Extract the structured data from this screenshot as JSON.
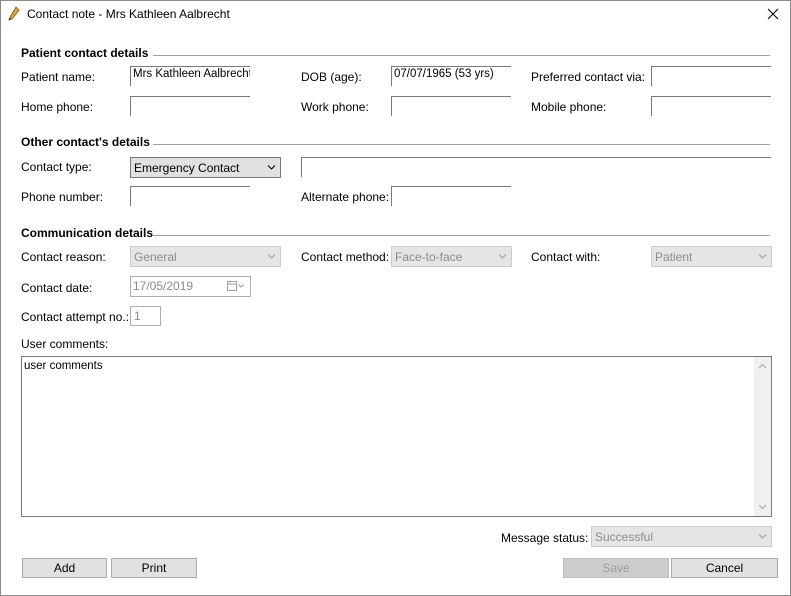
{
  "window": {
    "title": "Contact note - Mrs Kathleen Aalbrecht"
  },
  "patient_section": {
    "title": "Patient contact details",
    "patient_name_label": "Patient name:",
    "patient_name_value": "Mrs Kathleen Aalbrecht",
    "dob_label": "DOB (age):",
    "dob_value": "07/07/1965 (53 yrs)",
    "preferred_label": "Preferred contact via:",
    "preferred_value": "",
    "home_phone_label": "Home phone:",
    "home_phone_value": "",
    "work_phone_label": "Work phone:",
    "work_phone_value": "",
    "mobile_phone_label": "Mobile phone:",
    "mobile_phone_value": ""
  },
  "other_section": {
    "title": "Other contact's details",
    "contact_type_label": "Contact type:",
    "contact_type_value": "Emergency Contact",
    "contact_name_value": "",
    "phone_label": "Phone number:",
    "phone_value": "",
    "alt_phone_label": "Alternate phone:",
    "alt_phone_value": ""
  },
  "comm_section": {
    "title": "Communication details",
    "reason_label": "Contact reason:",
    "reason_value": "General",
    "method_label": "Contact method:",
    "method_value": "Face-to-face",
    "with_label": "Contact with:",
    "with_value": "Patient",
    "date_label": "Contact date:",
    "date_value": "17/05/2019",
    "attempt_label": "Contact attempt no.:",
    "attempt_value": "1",
    "comments_label": "User comments:",
    "comments_value": "user comments"
  },
  "footer": {
    "status_label": "Message status:",
    "status_value": "Successful",
    "add_label": "Add",
    "print_label": "Print",
    "save_label": "Save",
    "cancel_label": "Cancel"
  },
  "icons": {
    "app": "pen-nib-icon",
    "close": "close-icon",
    "dropdown": "chevron-down-icon",
    "calendar": "calendar-icon",
    "scroll_up": "scroll-up-arrow-icon",
    "scroll_down": "scroll-down-arrow-icon"
  },
  "colors": {
    "disabled_text": "#8c8c8c",
    "control_bg": "#e1e1e1",
    "border": "#7a7a7a"
  }
}
